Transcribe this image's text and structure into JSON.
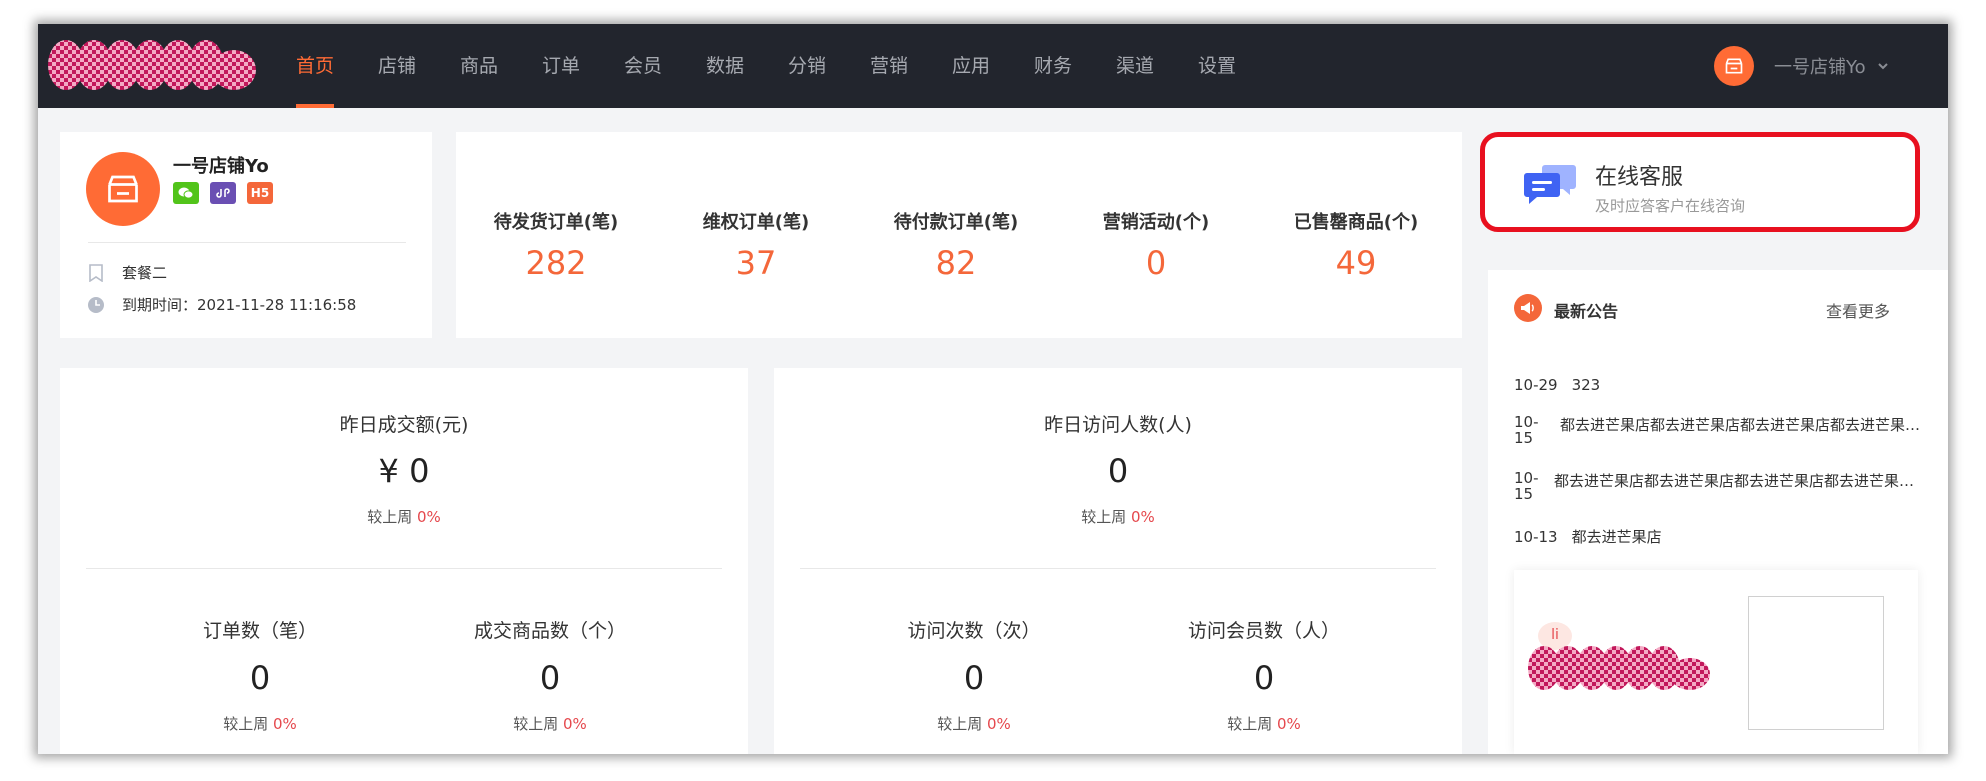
{
  "nav": {
    "items": [
      {
        "label": "首页",
        "active": true
      },
      {
        "label": "店铺"
      },
      {
        "label": "商品"
      },
      {
        "label": "订单"
      },
      {
        "label": "会员"
      },
      {
        "label": "数据"
      },
      {
        "label": "分销"
      },
      {
        "label": "营销"
      },
      {
        "label": "应用"
      },
      {
        "label": "财务"
      },
      {
        "label": "渠道"
      },
      {
        "label": "设置"
      }
    ],
    "store_name": "一号店铺Yo",
    "accent_color": "#ff6b35"
  },
  "shop": {
    "name": "一号店铺Yo",
    "badges": [
      "wechat-icon",
      "mini-program-icon",
      "H5"
    ],
    "plan": "套餐二",
    "expire": "到期时间：2021-11-28 11:16:58"
  },
  "stats": [
    {
      "label": "待发货订单(笔)",
      "value": "282"
    },
    {
      "label": "维权订单(笔)",
      "value": "37"
    },
    {
      "label": "待付款订单(笔)",
      "value": "82"
    },
    {
      "label": "营销活动(个)",
      "value": "0"
    },
    {
      "label": "已售罄商品(个)",
      "value": "49"
    }
  ],
  "service": {
    "title": "在线客服",
    "subtitle": "及时应答客户在线咨询"
  },
  "notice": {
    "title": "最新公告",
    "more": "查看更多",
    "items": [
      {
        "date": "10-29",
        "text": "323"
      },
      {
        "date": "10-15",
        "text": "都去进芒果店都去进芒果店都去进芒果店都去进芒果店都去进芒果店"
      },
      {
        "date": "10-15",
        "text": "都去进芒果店都去进芒果店都去进芒果店都去进芒果店都去进芒果店"
      },
      {
        "date": "10-13",
        "text": "都去进芒果店"
      }
    ],
    "promo_label": "li"
  },
  "sales": {
    "title": "昨日成交额(元)",
    "value": "¥ 0",
    "compare_label": "较上周",
    "compare_value": "0%",
    "subs": [
      {
        "title": "订单数（笔）",
        "value": "0",
        "compare_label": "较上周",
        "compare_value": "0%"
      },
      {
        "title": "成交商品数（个）",
        "value": "0",
        "compare_label": "较上周",
        "compare_value": "0%"
      }
    ]
  },
  "visits": {
    "title": "昨日访问人数(人)",
    "value": "0",
    "compare_label": "较上周",
    "compare_value": "0%",
    "subs": [
      {
        "title": "访问次数（次）",
        "value": "0",
        "compare_label": "较上周",
        "compare_value": "0%"
      },
      {
        "title": "访问会员数（人）",
        "value": "0",
        "compare_label": "较上周",
        "compare_value": "0%"
      }
    ]
  }
}
